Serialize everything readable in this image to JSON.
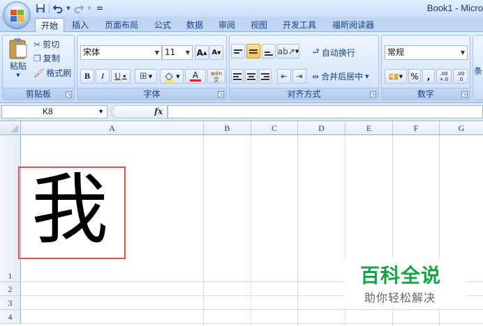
{
  "window": {
    "title": "Book1 - Micro"
  },
  "quick_access": {
    "customize": "="
  },
  "tabs": [
    {
      "label": "开始",
      "active": true
    },
    {
      "label": "插入"
    },
    {
      "label": "页面布局"
    },
    {
      "label": "公式"
    },
    {
      "label": "数据"
    },
    {
      "label": "审阅"
    },
    {
      "label": "视图"
    },
    {
      "label": "开发工具"
    },
    {
      "label": "福昕阅读器"
    }
  ],
  "clipboard": {
    "paste": "粘贴",
    "cut": "剪切",
    "copy": "复制",
    "format_painter": "格式刷",
    "label": "剪贴板"
  },
  "font": {
    "name": "宋体",
    "size": "11",
    "bold": "B",
    "italic": "I",
    "underline": "U",
    "font_color_letter": "A",
    "grow": "A",
    "shrink": "A",
    "phonetic": "wén\n文",
    "label": "字体"
  },
  "alignment": {
    "wrap_text": "自动换行",
    "merge_center": "合并后居中",
    "label": "对齐方式"
  },
  "number": {
    "format": "常规",
    "percent": "%",
    "comma": ",",
    "inc_decimal": ".00\n+.0",
    "dec_decimal": ".00\n.0",
    "label": "数字"
  },
  "styles": {
    "cond_format_partial": "条"
  },
  "formula_bar": {
    "name_box": "K8",
    "fx": "fx"
  },
  "columns": [
    "A",
    "B",
    "C",
    "D",
    "E",
    "F",
    "G"
  ],
  "rows": [
    "1",
    "2",
    "3",
    "4"
  ],
  "cell_A1": "我",
  "watermark": {
    "title": "百科全说",
    "subtitle": "助你轻松解决"
  },
  "colors": {
    "accent_red": "#d9534f",
    "watermark_green": "#17a247"
  }
}
